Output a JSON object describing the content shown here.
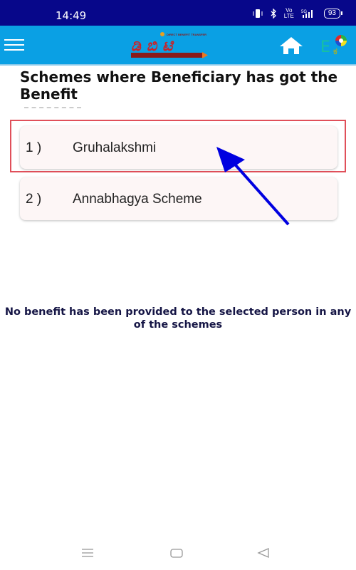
{
  "status_bar": {
    "time": "14:49",
    "network": "5G",
    "volte": "VoLTE",
    "battery": "93",
    "icons": [
      "vibrate-icon",
      "bluetooth-icon",
      "volte-icon",
      "signal-icon",
      "battery-icon"
    ]
  },
  "app_bar": {
    "logo_top_text": "DIRECT BENEFIT TRANSFER",
    "logo_text": "ಡಿಬಿಟಿ",
    "icons": [
      "menu-icon",
      "home-icon",
      "language-toggle-icon"
    ],
    "lang_label_en": "E",
    "lang_label_kn": "ಕ"
  },
  "page": {
    "title": "Schemes where Beneficiary has got the Benefit",
    "schemes": [
      {
        "number": "1 )",
        "name": "Gruhalakshmi",
        "highlighted": true
      },
      {
        "number": "2 )",
        "name": "Annabhagya Scheme",
        "highlighted": false
      }
    ],
    "no_benefit_message": "No benefit has been provided to the selected person in any of the schemes"
  },
  "annotation": {
    "arrow_color": "#0000e0",
    "highlight_color": "#e0505a"
  },
  "nav_bar": {
    "icons": [
      "recent-apps-icon",
      "home-nav-icon",
      "back-icon"
    ]
  }
}
